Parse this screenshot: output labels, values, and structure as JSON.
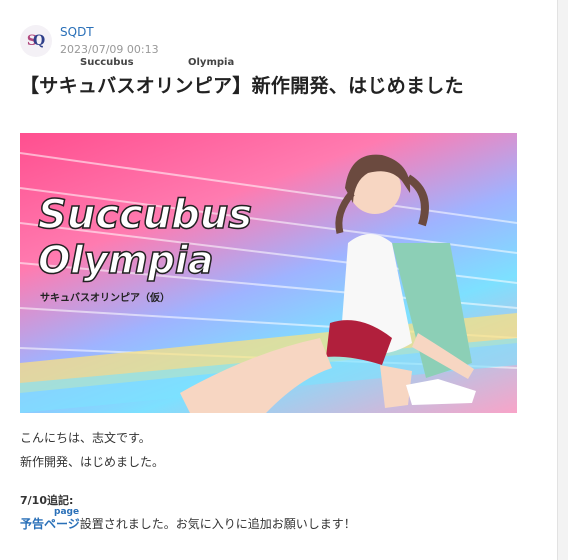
{
  "author": {
    "name": "SQDT",
    "date": "2023/07/09 00:13",
    "avatar_letters": [
      "S",
      "Q"
    ]
  },
  "article": {
    "title_ruby_1": "Succubus",
    "title_ruby_2": "Olympia",
    "title": "【サキュバスオリンピア】新作開発、はじめました",
    "hero_image": {
      "logo_line1": "Succubus",
      "logo_line2": "Olympia",
      "logo_sub": "サキュバスオリンピア（仮）"
    },
    "paragraphs": [
      "こんにちは、志文です。",
      "新作開発、はじめました。"
    ],
    "note_heading": "7/10追記:",
    "note_link_label": "予告ページ",
    "note_link_ruby": "page",
    "note_rest": "設置されました。お気に入りに追加お願いします！"
  }
}
